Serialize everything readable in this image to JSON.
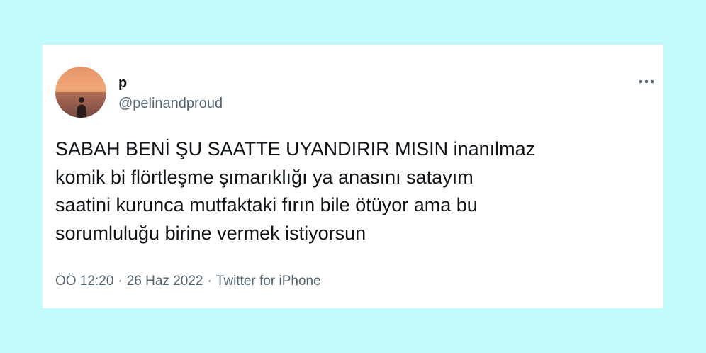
{
  "tweet": {
    "display_name": "p",
    "handle": "@pelinandproud",
    "text_lines": [
      "SABAH BENİ ŞU SAATTE UYANDIRIR MISIN inanılmaz",
      "komik bi flörtleşme şımarıklığı ya anasını satayım",
      "saatini kurunca mutfaktaki fırın bile ötüyor ama bu",
      "sorumluluğu birine vermek istiyorsun"
    ],
    "time": "ÖÖ 12:20",
    "date": "26 Haz 2022",
    "source": "Twitter for iPhone",
    "separator": "·",
    "more_icon": "more-horizontal-icon"
  },
  "colors": {
    "background": "#c2fbfb",
    "card": "#ffffff",
    "text_primary": "#0f1419",
    "text_secondary": "#536471"
  }
}
